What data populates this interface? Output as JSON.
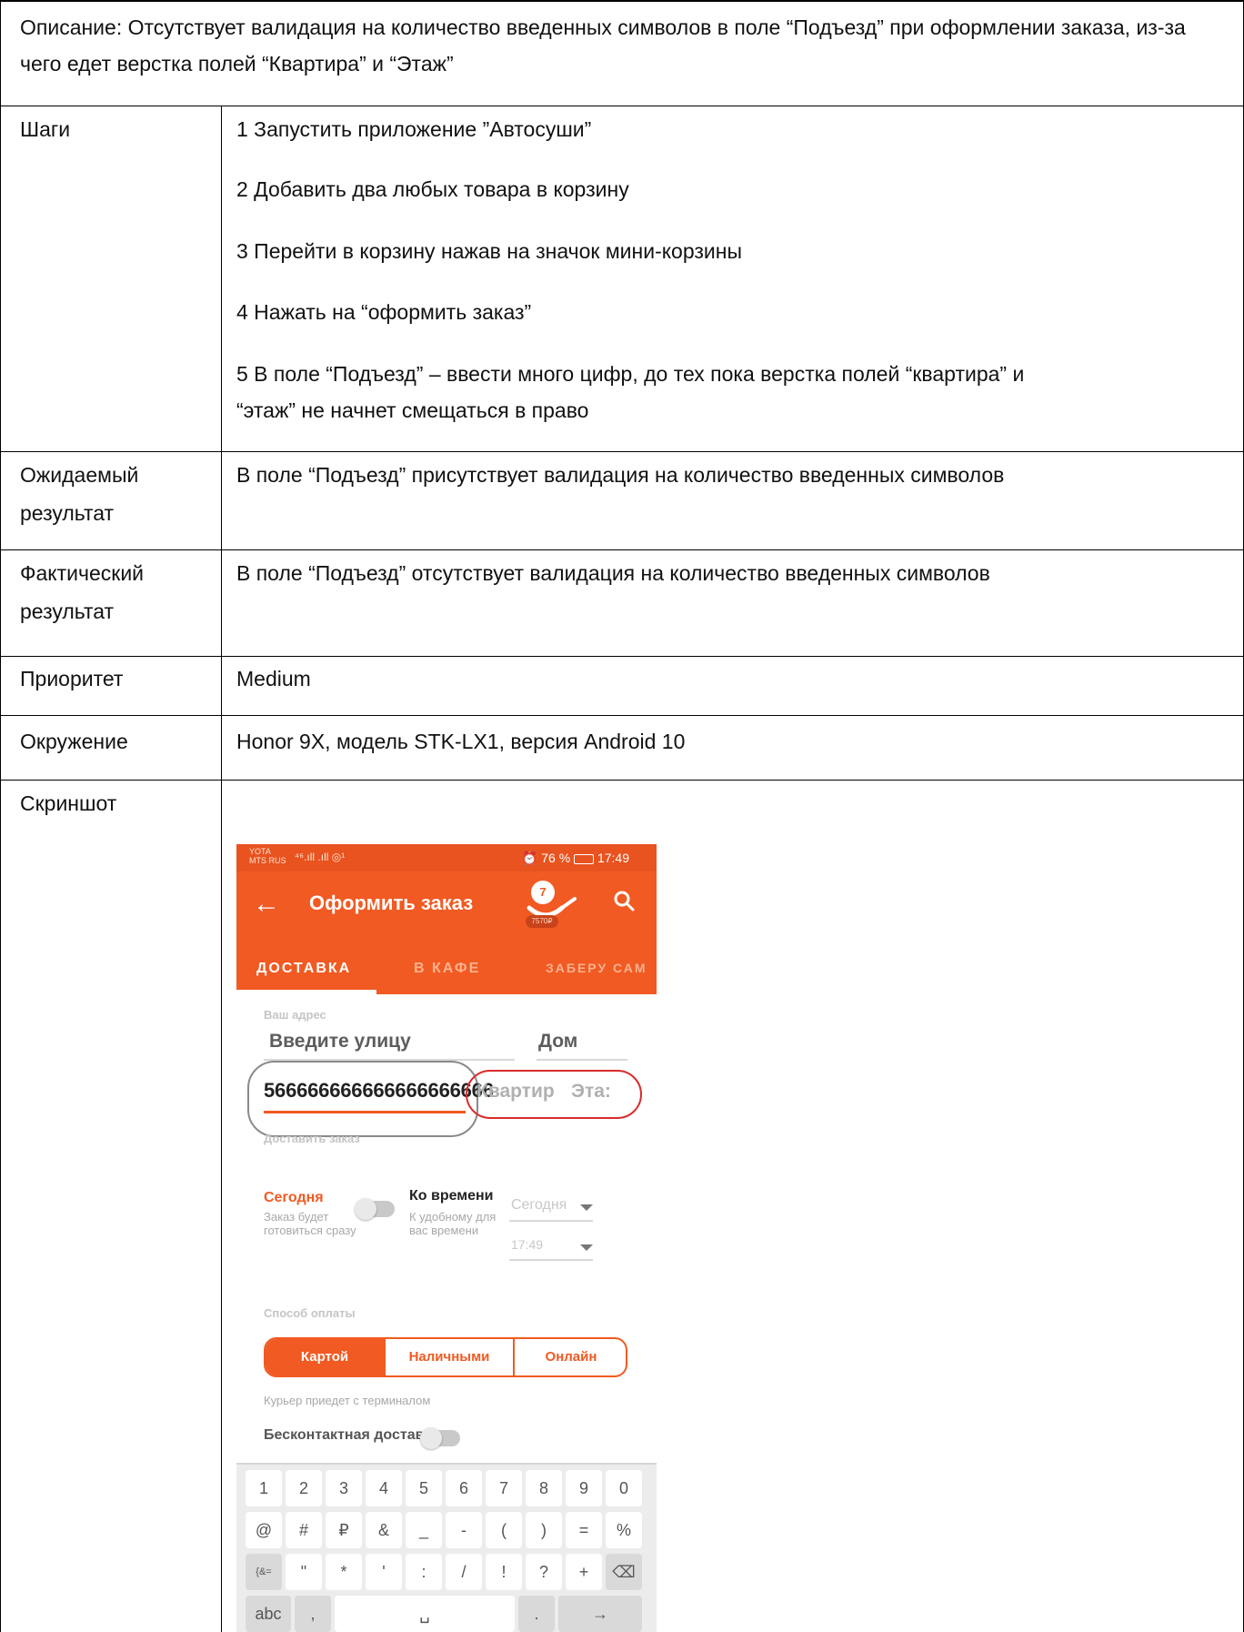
{
  "description": "Описание: Отсутствует валидация на количество введенных символов  в поле “Подъезд” при оформлении заказа, из-за чего едет верстка полей “Квартира” и “Этаж”",
  "rows": {
    "steps": {
      "label": "Шаги",
      "items": [
        "1 Запустить приложение  ”Автосуши”",
        "2 Добавить два любых товара в корзину",
        "3 Перейти в корзину нажав на значок мини-корзины",
        "4 Нажать на “оформить заказ”",
        "5 В поле “Подъезд” – ввести много цифр, до тех пока верстка полей “квартира” и",
        "“этаж” не начнет смещаться в право"
      ]
    },
    "expected": {
      "label_line1": "Ожидаемый",
      "label_line2": "результат",
      "value": "В поле “Подъезд” присутствует валидация на количество введенных символов"
    },
    "actual": {
      "label_line1": "Фактический",
      "label_line2": "результат",
      "value": "В поле “Подъезд” отсутствует валидация на количество введенных символов"
    },
    "priority": {
      "label": "Приоритет",
      "value": "Medium"
    },
    "environment": {
      "label": "Окружение",
      "value": "Honor 9X, модель STK-LX1, версия Android 10"
    },
    "screenshot": {
      "label": "Скриншот"
    }
  },
  "phone": {
    "status": {
      "carrier1": "YOTA",
      "carrier2": "MTS RUS",
      "signal": "⁴⁶.ıll .ıll ◎¹",
      "battery": "76 %",
      "time": "17:49"
    },
    "appbar": {
      "title": "Оформить заказ",
      "cart_count": "7",
      "cart_sum": "7570₽"
    },
    "tabs": [
      "ДОСТАВКА",
      "В КАФЕ",
      "ЗАБЕРУ САМ"
    ],
    "address_label": "Ваш адрес",
    "street_placeholder": "Введите улицу",
    "house_placeholder": "Дом",
    "entrance_value": "566666666666666666666",
    "apartment_placeholder": "Квартир",
    "floor_placeholder": "Эта:",
    "deliver_label": "Доставить заказ",
    "today_title": "Сегодня",
    "today_sub1": "Заказ будет",
    "today_sub2": "готовиться сразу",
    "ontime_title": "Ко времени",
    "ontime_sub1": "К удобному для",
    "ontime_sub2": "вас времени",
    "day_select": "Сегодня",
    "time_select": "17:49",
    "payment_label": "Способ оплаты",
    "payment_options": [
      "Картой",
      "Наличными",
      "Онлайн"
    ],
    "courier_note": "Курьер приедет с терминалом",
    "contactless": "Бесконтактная доставка",
    "keys_row1": [
      "1",
      "2",
      "3",
      "4",
      "5",
      "6",
      "7",
      "8",
      "9",
      "0"
    ],
    "keys_row2": [
      "@",
      "#",
      "₽",
      "&",
      "_",
      "-",
      "(",
      ")",
      "=",
      "%"
    ],
    "keys_row3": [
      "{&=",
      "\"",
      "*",
      "'",
      ":",
      "/",
      "!",
      "?",
      "+",
      "⌫"
    ],
    "keys_row4": [
      "abc",
      ",",
      "␣",
      ".",
      "→"
    ],
    "nav": [
      "▽",
      "○",
      "□"
    ]
  }
}
